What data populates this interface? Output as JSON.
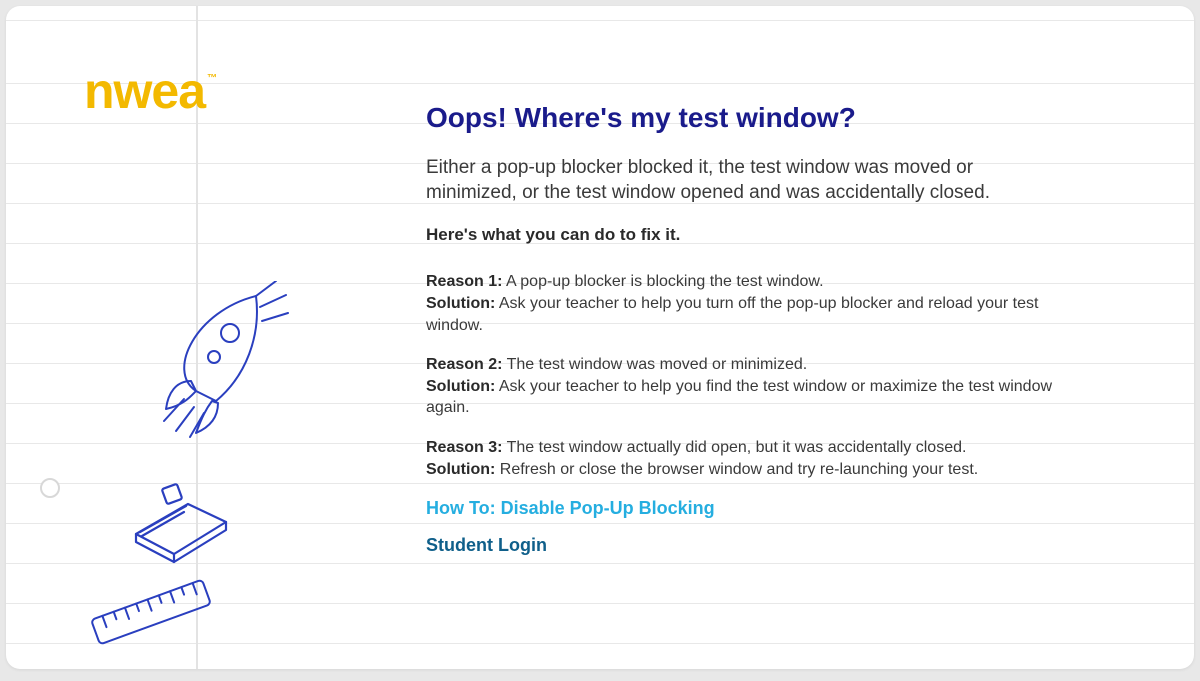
{
  "brand": {
    "name": "nwea",
    "tm": "™"
  },
  "heading": "Oops! Where's my test window?",
  "intro": "Either a pop-up blocker blocked it, the test window was moved or minimized, or the test window opened and was accidentally closed.",
  "fix_heading": "Here's what you can do to fix it.",
  "reasons": [
    {
      "label": "Reason 1:",
      "text": " A pop-up blocker is blocking the test window.",
      "sol_label": "Solution:",
      "sol_text": " Ask your teacher to help you turn off the pop-up blocker and reload your test window."
    },
    {
      "label": "Reason 2:",
      "text": " The test window was moved or minimized.",
      "sol_label": "Solution:",
      "sol_text": " Ask your teacher to help you find the test window or maximize the test window again."
    },
    {
      "label": "Reason 3:",
      "text": " The test window actually did open, but it was accidentally closed.",
      "sol_label": "Solution:",
      "sol_text": " Refresh or close the browser window and try re-launching your test."
    }
  ],
  "links": {
    "howto": "How To: Disable Pop-Up Blocking",
    "login": "Student Login"
  },
  "doodle_names": {
    "rocket": "rocket-doodle-icon",
    "book": "book-doodle-icon",
    "ruler": "ruler-doodle-icon"
  }
}
